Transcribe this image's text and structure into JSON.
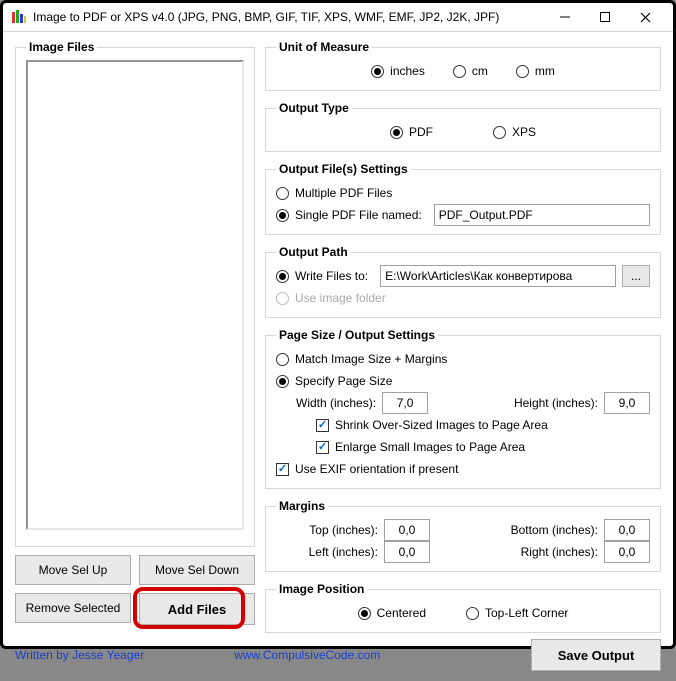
{
  "title": "Image to PDF or XPS  v4.0   (JPG, PNG, BMP, GIF, TIF, XPS, WMF, EMF, JP2, J2K, JPF)",
  "left": {
    "legend": "Image Files",
    "move_up": "Move Sel Up",
    "move_down": "Move Sel Down",
    "remove": "Remove Selected",
    "add": "Add Files"
  },
  "unit": {
    "legend": "Unit of Measure",
    "inches": "inches",
    "cm": "cm",
    "mm": "mm"
  },
  "outtype": {
    "legend": "Output Type",
    "pdf": "PDF",
    "xps": "XPS"
  },
  "outfiles": {
    "legend": "Output File(s) Settings",
    "multiple": "Multiple PDF Files",
    "single": "Single PDF File named:",
    "single_name": "PDF_Output.PDF"
  },
  "outpath": {
    "legend": "Output Path",
    "write_to": "Write Files to:",
    "path": "E:\\Work\\Articles\\Как конвертирова",
    "browse": "...",
    "use_img": "Use image folder"
  },
  "pagesize": {
    "legend": "Page Size / Output Settings",
    "match": "Match Image Size + Margins",
    "specify": "Specify Page Size",
    "width_lbl": "Width (inches):",
    "width_val": "7,0",
    "height_lbl": "Height (inches):",
    "height_val": "9,0",
    "shrink": "Shrink Over-Sized Images to Page Area",
    "enlarge": "Enlarge Small Images to Page Area",
    "exif": "Use EXIF orientation if present"
  },
  "margins": {
    "legend": "Margins",
    "top": "Top (inches):",
    "top_v": "0,0",
    "bottom": "Bottom (inches):",
    "bottom_v": "0,0",
    "left": "Left (inches):",
    "left_v": "0,0",
    "right": "Right (inches):",
    "right_v": "0,0"
  },
  "imgpos": {
    "legend": "Image Position",
    "centered": "Centered",
    "topleft": "Top-Left Corner"
  },
  "footer": {
    "author": "Written by Jesse Yeager",
    "site": "www.CompulsiveCode.com",
    "save": "Save Output"
  }
}
